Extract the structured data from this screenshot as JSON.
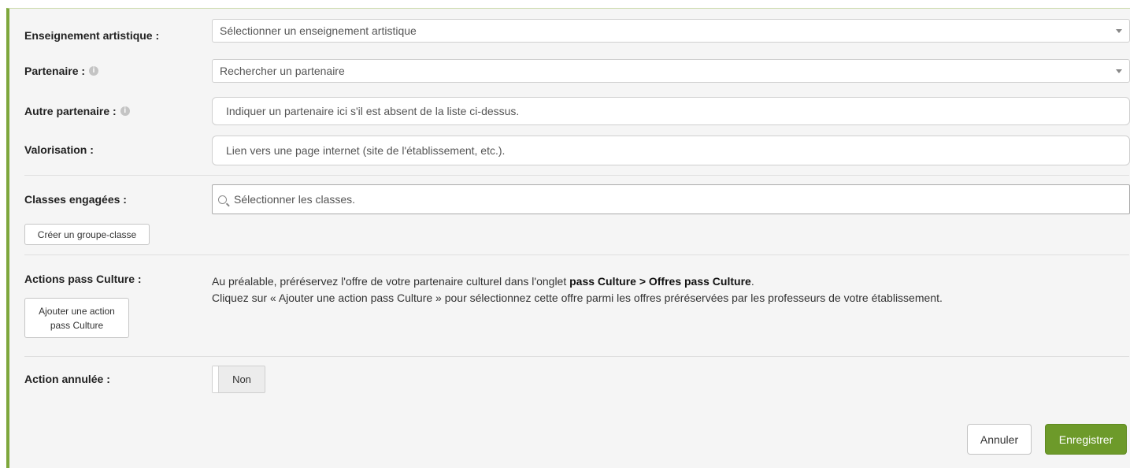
{
  "form": {
    "enseignement": {
      "label": "Enseignement artistique :",
      "placeholder": "Sélectionner un enseignement artistique"
    },
    "partenaire": {
      "label": "Partenaire :",
      "placeholder": "Rechercher un partenaire"
    },
    "autre_partenaire": {
      "label": "Autre partenaire :",
      "placeholder": "Indiquer un partenaire ici s'il est absent de la liste ci-dessus."
    },
    "valorisation": {
      "label": "Valorisation :",
      "placeholder": "Lien vers une page internet (site de l'établissement, etc.)."
    },
    "classes": {
      "label": "Classes engagées :",
      "placeholder": "Sélectionner les classes.",
      "create_group_button": "Créer un groupe-classe"
    },
    "pass_culture": {
      "label": "Actions pass Culture :",
      "add_button_line1": "Ajouter une action",
      "add_button_line2": "pass Culture",
      "info_line1_prefix": "Au préalable, préréservez l'offre de votre partenaire culturel dans l'onglet ",
      "info_line1_bold": "pass Culture > Offres pass Culture",
      "info_line1_suffix": ".",
      "info_line2": "Cliquez sur « Ajouter une action pass Culture » pour sélectionnez cette offre parmi les offres préréservées par les professeurs de votre établissement."
    },
    "action_annulee": {
      "label": "Action annulée :",
      "toggle_value": "Non"
    },
    "buttons": {
      "cancel": "Annuler",
      "save": "Enregistrer"
    }
  },
  "colors": {
    "accent": "#7ea73c",
    "save_button": "#6d9a2a",
    "panel_background": "#f5f5f5"
  },
  "icons": {
    "info": "info-circle-icon",
    "dropdown": "chevron-down-icon",
    "search": "search-icon"
  }
}
